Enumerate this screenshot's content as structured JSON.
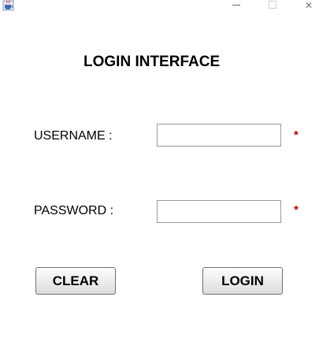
{
  "window": {
    "icon": "java-cup-icon",
    "controls": [
      "minimize",
      "maximize",
      "close"
    ],
    "close_glyph": "✕"
  },
  "form": {
    "title": "LOGIN INTERFACE",
    "username_label": "USERNAME :",
    "username_value": "",
    "password_label": "PASSWORD :",
    "password_value": "",
    "required_mark": "*",
    "required_color": "#c00000"
  },
  "buttons": {
    "clear_label": "CLEAR",
    "login_label": "LOGIN"
  }
}
